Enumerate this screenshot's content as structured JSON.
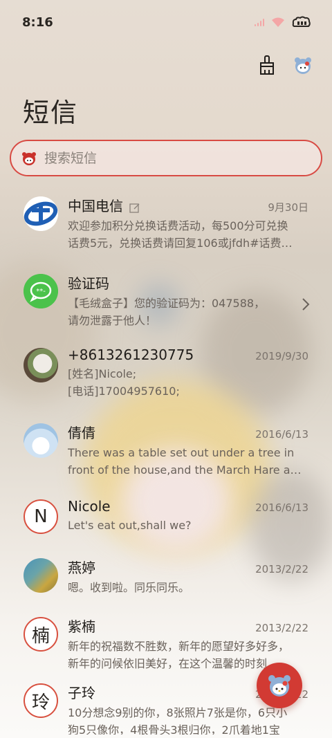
{
  "status": {
    "time": "8:16"
  },
  "header": {
    "title": "短信"
  },
  "search": {
    "placeholder": "搜索短信"
  },
  "messages": [
    {
      "name": "中国电信",
      "date": "9月30日",
      "lines": [
        "欢迎参加积分兑换话费活动，每500分可兑换",
        "话费5元，兑换话费请回复106或jfdh#话费…"
      ],
      "avatar": "china-telecom-logo"
    },
    {
      "name": "验证码",
      "date": "",
      "lines": [
        "【毛绒盒子】您的验证码为：047588，",
        "请勿泄露于他人！"
      ],
      "avatar": "verification-chat-icon"
    },
    {
      "name": "+8613261230775",
      "date": "2019/9/30",
      "lines": [
        "[姓名]Nicole;",
        "[电话]17004957610;"
      ],
      "avatar": "photo-plush-toy"
    },
    {
      "name": "倩倩",
      "date": "2016/6/13",
      "lines": [
        "There was a table set out under a tree in",
        "front of the house,and the March Hare an…"
      ],
      "avatar": "photo-polar-bear"
    },
    {
      "name": "Nicole",
      "date": "2016/6/13",
      "lines": [
        "Let's eat out,shall we?"
      ],
      "avatar": "letter",
      "initial": "N"
    },
    {
      "name": "燕婷",
      "date": "2013/2/22",
      "lines": [
        "嗯。收到啦。同乐同乐。"
      ],
      "avatar": "photo-landscape"
    },
    {
      "name": "紫楠",
      "date": "2013/2/22",
      "lines": [
        "新年的祝福数不胜数，新年的愿望好多好多，",
        "新年的问候依旧美好，在这个温馨的时刻，…"
      ],
      "avatar": "letter",
      "initial": "楠"
    },
    {
      "name": "子玲",
      "date": "2013/2/22",
      "lines": [
        "10分想念9别的你，8张照片7张是你，6只小",
        "狗5只像你，4根骨头3根归你，2爪着地1宝"
      ],
      "avatar": "letter",
      "initial": "玲"
    }
  ],
  "colors": {
    "accent": "#d23a33",
    "search_border": "#d84a43",
    "text_primary": "#1f1c19",
    "text_secondary": "#6a625b"
  }
}
